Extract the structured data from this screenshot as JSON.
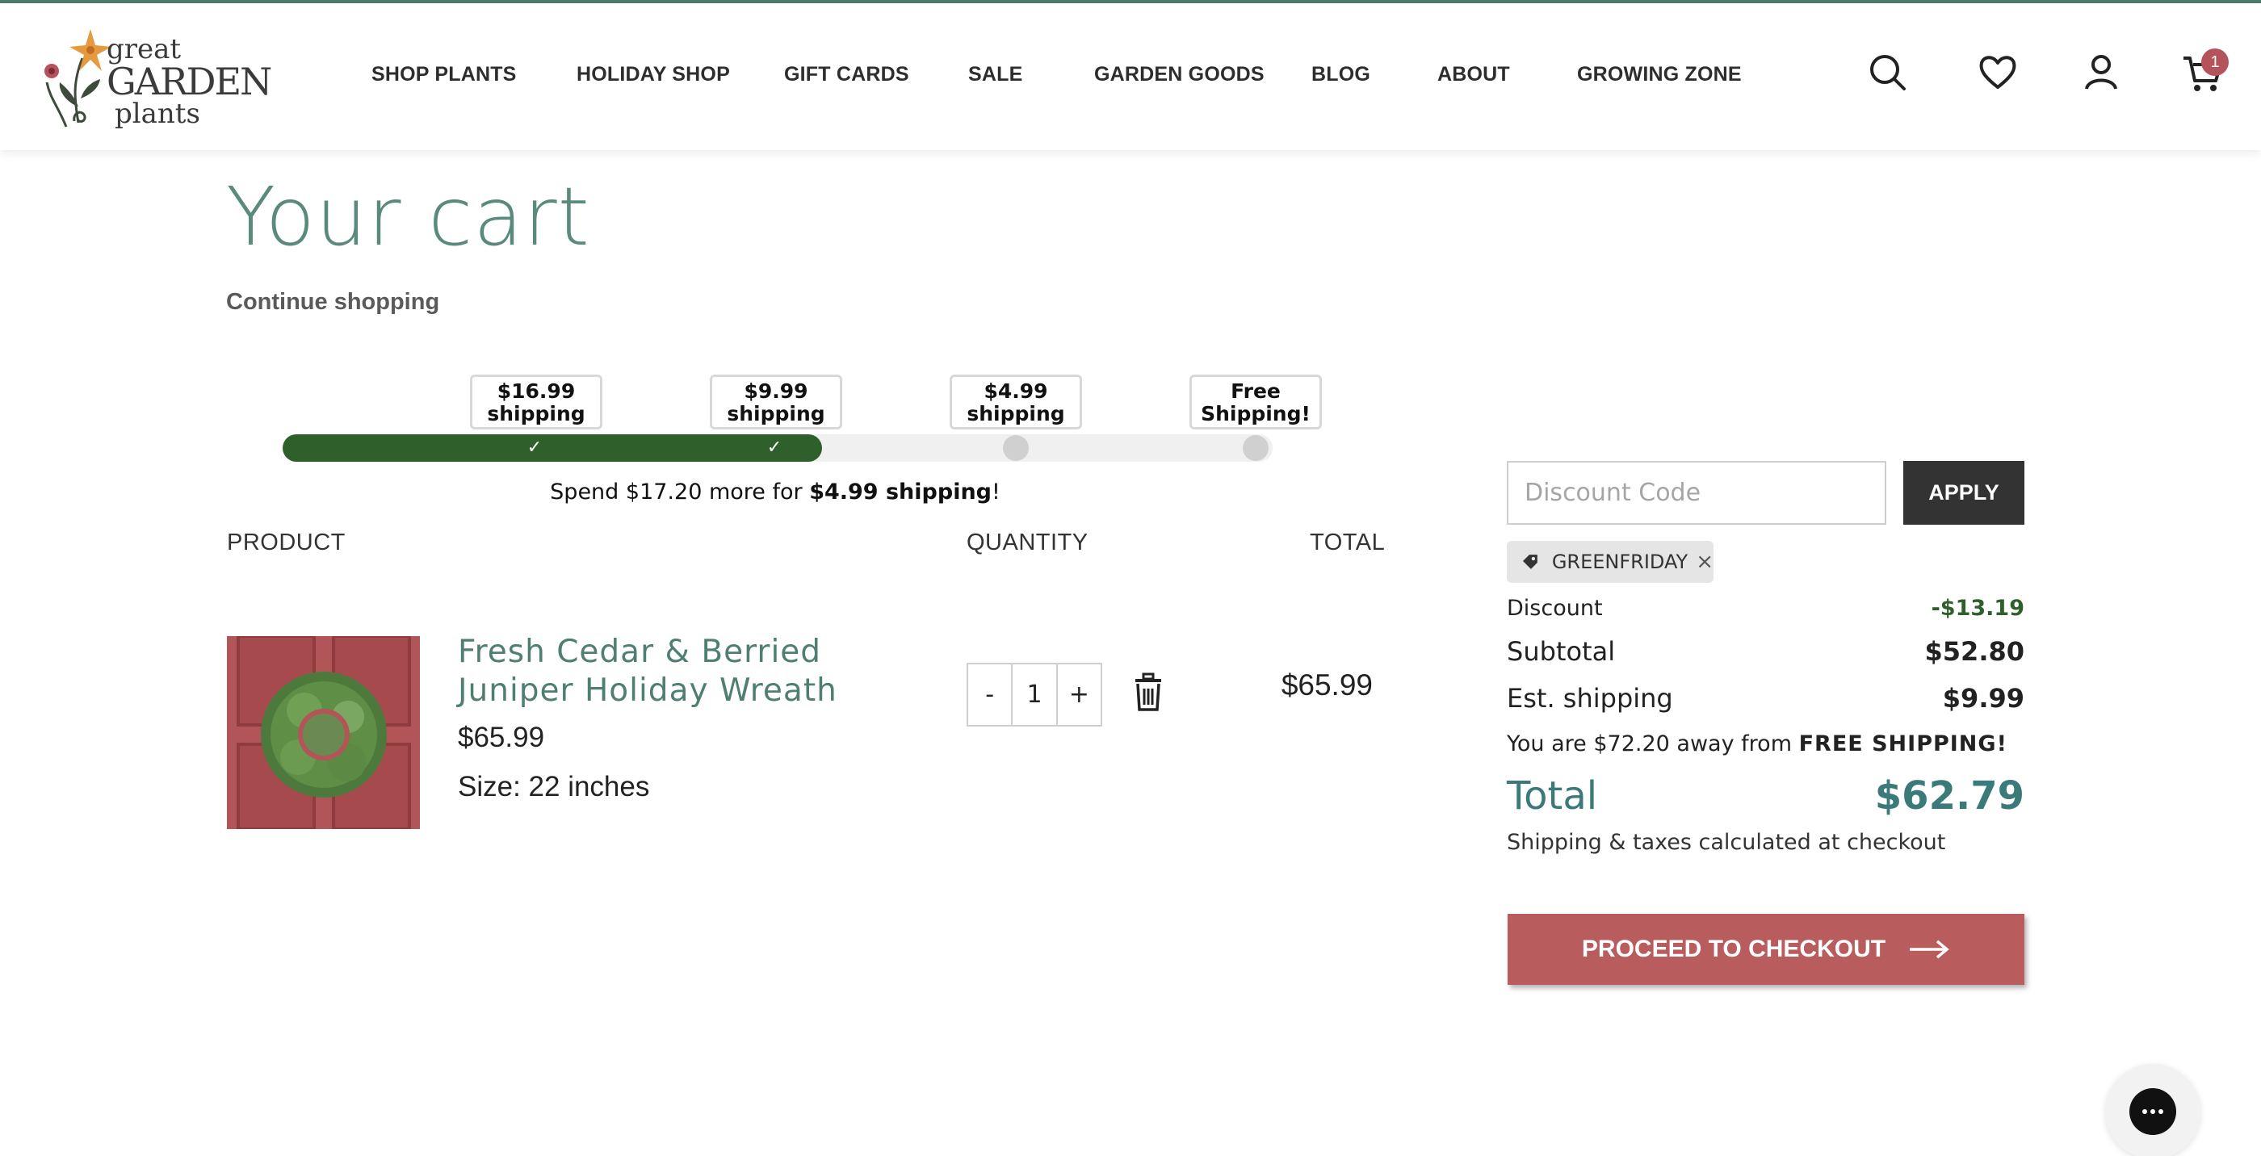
{
  "brand": {
    "logo_line1": "great",
    "logo_line2": "GARDEN",
    "logo_line3": "plants"
  },
  "nav": {
    "items": [
      "SHOP PLANTS",
      "HOLIDAY SHOP",
      "GIFT CARDS",
      "SALE",
      "GARDEN GOODS",
      "BLOG",
      "ABOUT",
      "GROWING ZONE"
    ]
  },
  "header_icons": [
    "search-icon",
    "heart-icon",
    "user-icon",
    "cart-icon"
  ],
  "cart_count": "1",
  "page": {
    "title": "Your cart",
    "continue_link": "Continue shopping"
  },
  "shipping_progress": {
    "tiers": [
      {
        "line1": "$16.99",
        "line2": "shipping",
        "reached": true
      },
      {
        "line1": "$9.99",
        "line2": "shipping",
        "reached": true
      },
      {
        "line1": "$4.99",
        "line2": "shipping",
        "reached": false
      },
      {
        "line1": "Free",
        "line2": "Shipping!",
        "reached": false
      }
    ],
    "message_prefix": "Spend $17.20 more for ",
    "message_bold": "$4.99 shipping",
    "message_suffix": "!"
  },
  "table": {
    "col_product": "PRODUCT",
    "col_quantity": "QUANTITY",
    "col_total": "TOTAL"
  },
  "line_item": {
    "name": "Fresh Cedar & Berried Juniper Holiday Wreath",
    "price": "$65.99",
    "size": "Size: 22 inches",
    "qty_minus": "-",
    "qty": "1",
    "qty_plus": "+",
    "total": "$65.99"
  },
  "summary": {
    "discount_placeholder": "Discount Code",
    "apply_label": "APPLY",
    "applied_code": "GREENFRIDAY",
    "chip_remove": "×",
    "discount_label": "Discount",
    "discount_value": "-$13.19",
    "subtotal_label": "Subtotal",
    "subtotal_value": "$52.80",
    "shipping_label": "Est. shipping",
    "shipping_value": "$9.99",
    "away_prefix": "You are $72.20 away from ",
    "away_bold": "FREE SHIPPING!",
    "total_label": "Total",
    "total_value": "$62.79",
    "tax_note": "Shipping & taxes calculated at checkout",
    "checkout_label": "PROCEED TO CHECKOUT"
  },
  "colors": {
    "brand_teal": "#5a8a7d",
    "progress_green": "#2f5f2b",
    "checkout_red": "#b85c5d",
    "badge_red": "#b5535a"
  }
}
